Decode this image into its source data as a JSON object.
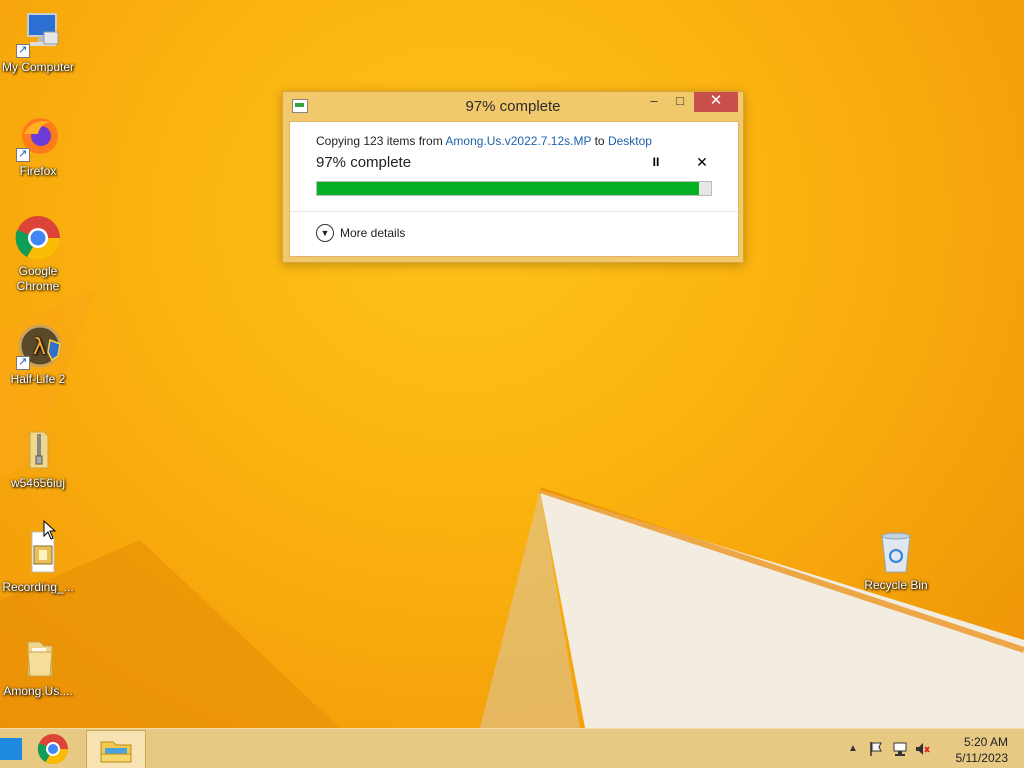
{
  "desktop": {
    "icons": [
      {
        "label": "My Computer",
        "icon": "computer-icon"
      },
      {
        "label": "Firefox",
        "icon": "firefox-icon"
      },
      {
        "label": "Google Chrome",
        "icon": "chrome-icon"
      },
      {
        "label": "Half-Life 2",
        "icon": "half-life-2-icon"
      },
      {
        "label": "w54656iuj",
        "icon": "zip-folder-icon"
      },
      {
        "label": "Recording_...",
        "icon": "recording-file-icon"
      },
      {
        "label": "Among.Us....",
        "icon": "folder-icon"
      },
      {
        "label": "Recycle Bin",
        "icon": "recycle-bin-icon"
      }
    ]
  },
  "dialog": {
    "title": "97% complete",
    "copy_prefix": "Copying 123 items from ",
    "source": "Among.Us.v2022.7.12s.MP",
    "copy_to": " to ",
    "destination": "Desktop",
    "status": "97% complete",
    "progress_percent": 97,
    "more_details": "More details",
    "titlebar_buttons": {
      "minimize": "–",
      "maximize": "□",
      "close": "✕"
    },
    "pause_symbol": "II",
    "cancel_symbol": "✕",
    "colors": {
      "progress": "#06b025",
      "link": "#1e62a8",
      "frame": "#f1c86b",
      "close": "#c7504a"
    }
  },
  "taskbar": {
    "pinned": [
      {
        "name": "Google Chrome",
        "icon": "chrome-icon"
      },
      {
        "name": "File Explorer",
        "icon": "file-explorer-icon"
      }
    ],
    "tray": {
      "time": "5:20 AM",
      "date": "5/11/2023",
      "icons": [
        "show-hidden-icons-icon",
        "action-center-flag-icon",
        "network-icon",
        "volume-muted-icon"
      ]
    }
  }
}
